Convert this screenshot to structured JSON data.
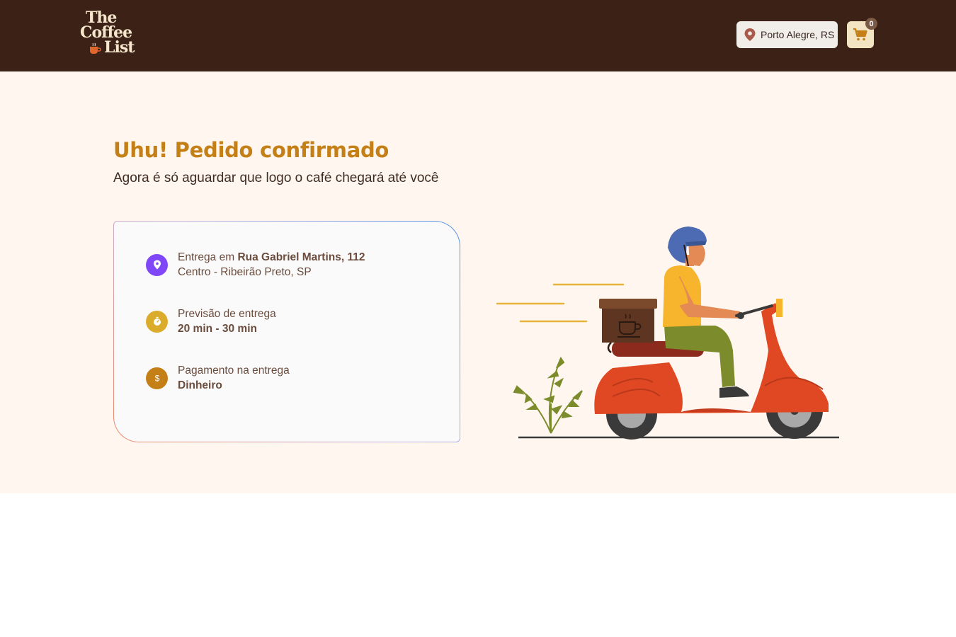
{
  "header": {
    "logo": {
      "line1": "The",
      "line2": "Coffee",
      "line3": "List"
    },
    "location_label": "Porto Alegre, RS",
    "cart_count": "0",
    "icons": {
      "location": "map-pin-icon",
      "cart": "shopping-cart-icon"
    }
  },
  "confirmation": {
    "title": "Uhu! Pedido confirmado",
    "subtitle": "Agora é só aguardar que logo o café chegará até você"
  },
  "order_info": {
    "delivery": {
      "prefix": "Entrega em ",
      "street": "Rua Gabriel Martins, 112",
      "district": "Centro - Ribeirão Preto, SP",
      "icon": "map-pin-icon",
      "icon_color": "#8047f8"
    },
    "eta": {
      "label": "Previsão de entrega",
      "value": "20 min - 30 min",
      "icon": "timer-icon",
      "icon_color": "#dbac2c"
    },
    "payment": {
      "label": "Pagamento na entrega",
      "value": "Dinheiro",
      "icon": "currency-dollar-icon",
      "icon_color": "#c47f17"
    }
  },
  "colors": {
    "header_bg": "#3c2216",
    "page_bg": "#fff7ef",
    "title": "#c47f17",
    "cart_bg": "#f3e5c3"
  }
}
